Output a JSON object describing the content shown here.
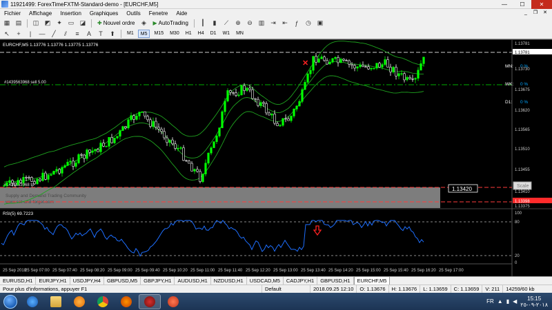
{
  "window": {
    "title": "11921499: ForexTimeFXTM-Standard-demo - [EURCHF,M5]",
    "min_label": "—",
    "max_label": "☐",
    "close_label": "✕"
  },
  "menu": [
    "Fichier",
    "Affichage",
    "Insertion",
    "Graphiques",
    "Outils",
    "Fenetre",
    "Aide"
  ],
  "mdi_controls": [
    "_",
    "❐",
    "✕"
  ],
  "toolbar": {
    "new_order_label": "Nouvel ordre",
    "autotrading_label": "AutoTrading",
    "timeframes": [
      "M1",
      "M5",
      "M15",
      "M30",
      "H1",
      "H4",
      "D1",
      "W1",
      "MN"
    ],
    "active_timeframe": "M5"
  },
  "chart": {
    "header": "EURCHF,M5  1.13776 1.13776 1.13775 1.13776",
    "price_labels": [
      "1.13781",
      "1.13775",
      "1.13730",
      "1.13675",
      "1.13620",
      "1.13565",
      "1.13510",
      "1.13455",
      "1.13410",
      "1.13398",
      "1.13375"
    ],
    "current_price_tag": "1.13781",
    "red_price_tag": "1.13398",
    "order_line_1": "#1439563968 sell 5.00",
    "order_line_2": "#1439563968 tp",
    "supply_demand_line_1": "Supply and Demand Trading Community",
    "supply_demand_line_2": "www.set-and-forget.com",
    "crosshair_price": "1.13420",
    "scale_button": "Scale",
    "mn_label": "MN:",
    "mn_value": "0 %",
    "wk_label": "WK:",
    "wk_value": "0 %",
    "d1_label": "D1:",
    "d1_value": "0 %",
    "rsi_header": "RSI(5) 69.7223",
    "rsi_levels": [
      "100",
      "80",
      "20",
      "0"
    ],
    "time_labels": [
      "25 Sep 2018",
      "25 Sep 07:00",
      "25 Sep 07:40",
      "25 Sep 08:20",
      "25 Sep 09:00",
      "25 Sep 09:40",
      "25 Sep 10:20",
      "25 Sep 11:00",
      "25 Sep 11:40",
      "25 Sep 12:20",
      "25 Sep 13:00",
      "25 Sep 13:40",
      "25 Sep 14:20",
      "25 Sep 15:00",
      "25 Sep 15:40",
      "25 Sep 16:20",
      "25 Sep 17:00"
    ]
  },
  "tabs": [
    "EURUSD,H1",
    "EURJPY,H1",
    "USDJPY,H4",
    "GBPUSD,M5",
    "GBPJPY,H1",
    "AUDUSD,H1",
    "NZDUSD,H1",
    "USDCAD,M5",
    "CADJPY,H1",
    "GBPUSD,H1",
    "EURCHF,M5"
  ],
  "active_tab": "EURCHF,M5",
  "status": {
    "help": "Pour plus d'informations, appuyer F1",
    "profile": "Default",
    "datetime": "2018.09.25 12:10",
    "open": "O: 1.13676",
    "high": "H: 1.13676",
    "low": "L: 1.13659",
    "close": "C: 1.13659",
    "volume": "V: 211",
    "traffic": "14259/60 kb"
  },
  "taskbar": {
    "lang": "FR",
    "time": "15:15",
    "date": "٢٠١٨-٠٩-٢٥"
  },
  "colors": {
    "bull": "#00ff00",
    "bear": "#ffffff",
    "bands": "#1fa31f",
    "rsi": "#1e6fff",
    "grid": "#606060",
    "order_line": "#00cc00",
    "tp_line": "#ff3b3b"
  }
}
